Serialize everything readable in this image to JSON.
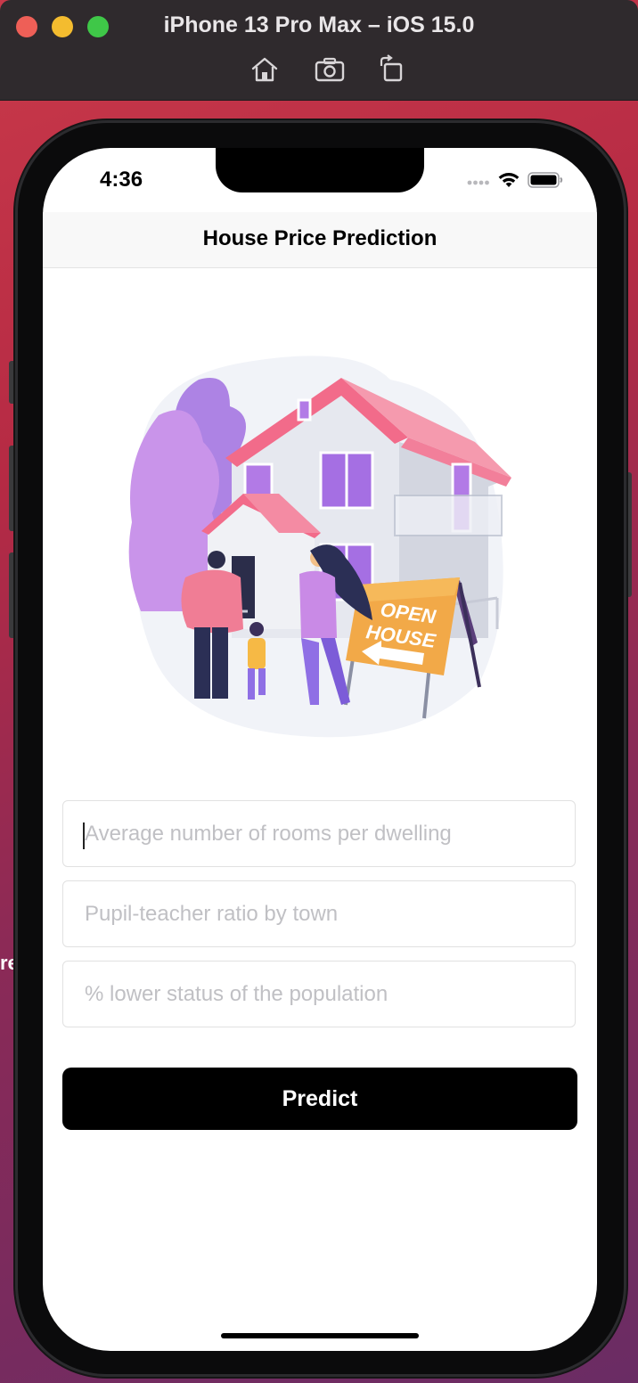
{
  "simulator": {
    "title": "iPhone 13 Pro Max – iOS 15.0",
    "tools": [
      "home-icon",
      "screenshot-icon",
      "rotate-icon"
    ]
  },
  "desktop": {
    "edge_text": "re"
  },
  "status_bar": {
    "time": "4:36",
    "icons": [
      "signal-dots-icon",
      "wifi-icon",
      "battery-icon"
    ]
  },
  "nav": {
    "title": "House Price Prediction"
  },
  "illustration": {
    "sign_line1": "OPEN",
    "sign_line2": "HOUSE"
  },
  "form": {
    "rooms": {
      "placeholder": "Average number of rooms per dwelling",
      "value": ""
    },
    "ptratio": {
      "placeholder": "Pupil-teacher ratio by town",
      "value": ""
    },
    "lstat": {
      "placeholder": "% lower status of the population",
      "value": ""
    }
  },
  "predict_label": "Predict",
  "colors": {
    "button": "#000000",
    "roof": "#f06d8a",
    "accent_purple": "#9b6ee0",
    "sign": "#f2a948"
  }
}
